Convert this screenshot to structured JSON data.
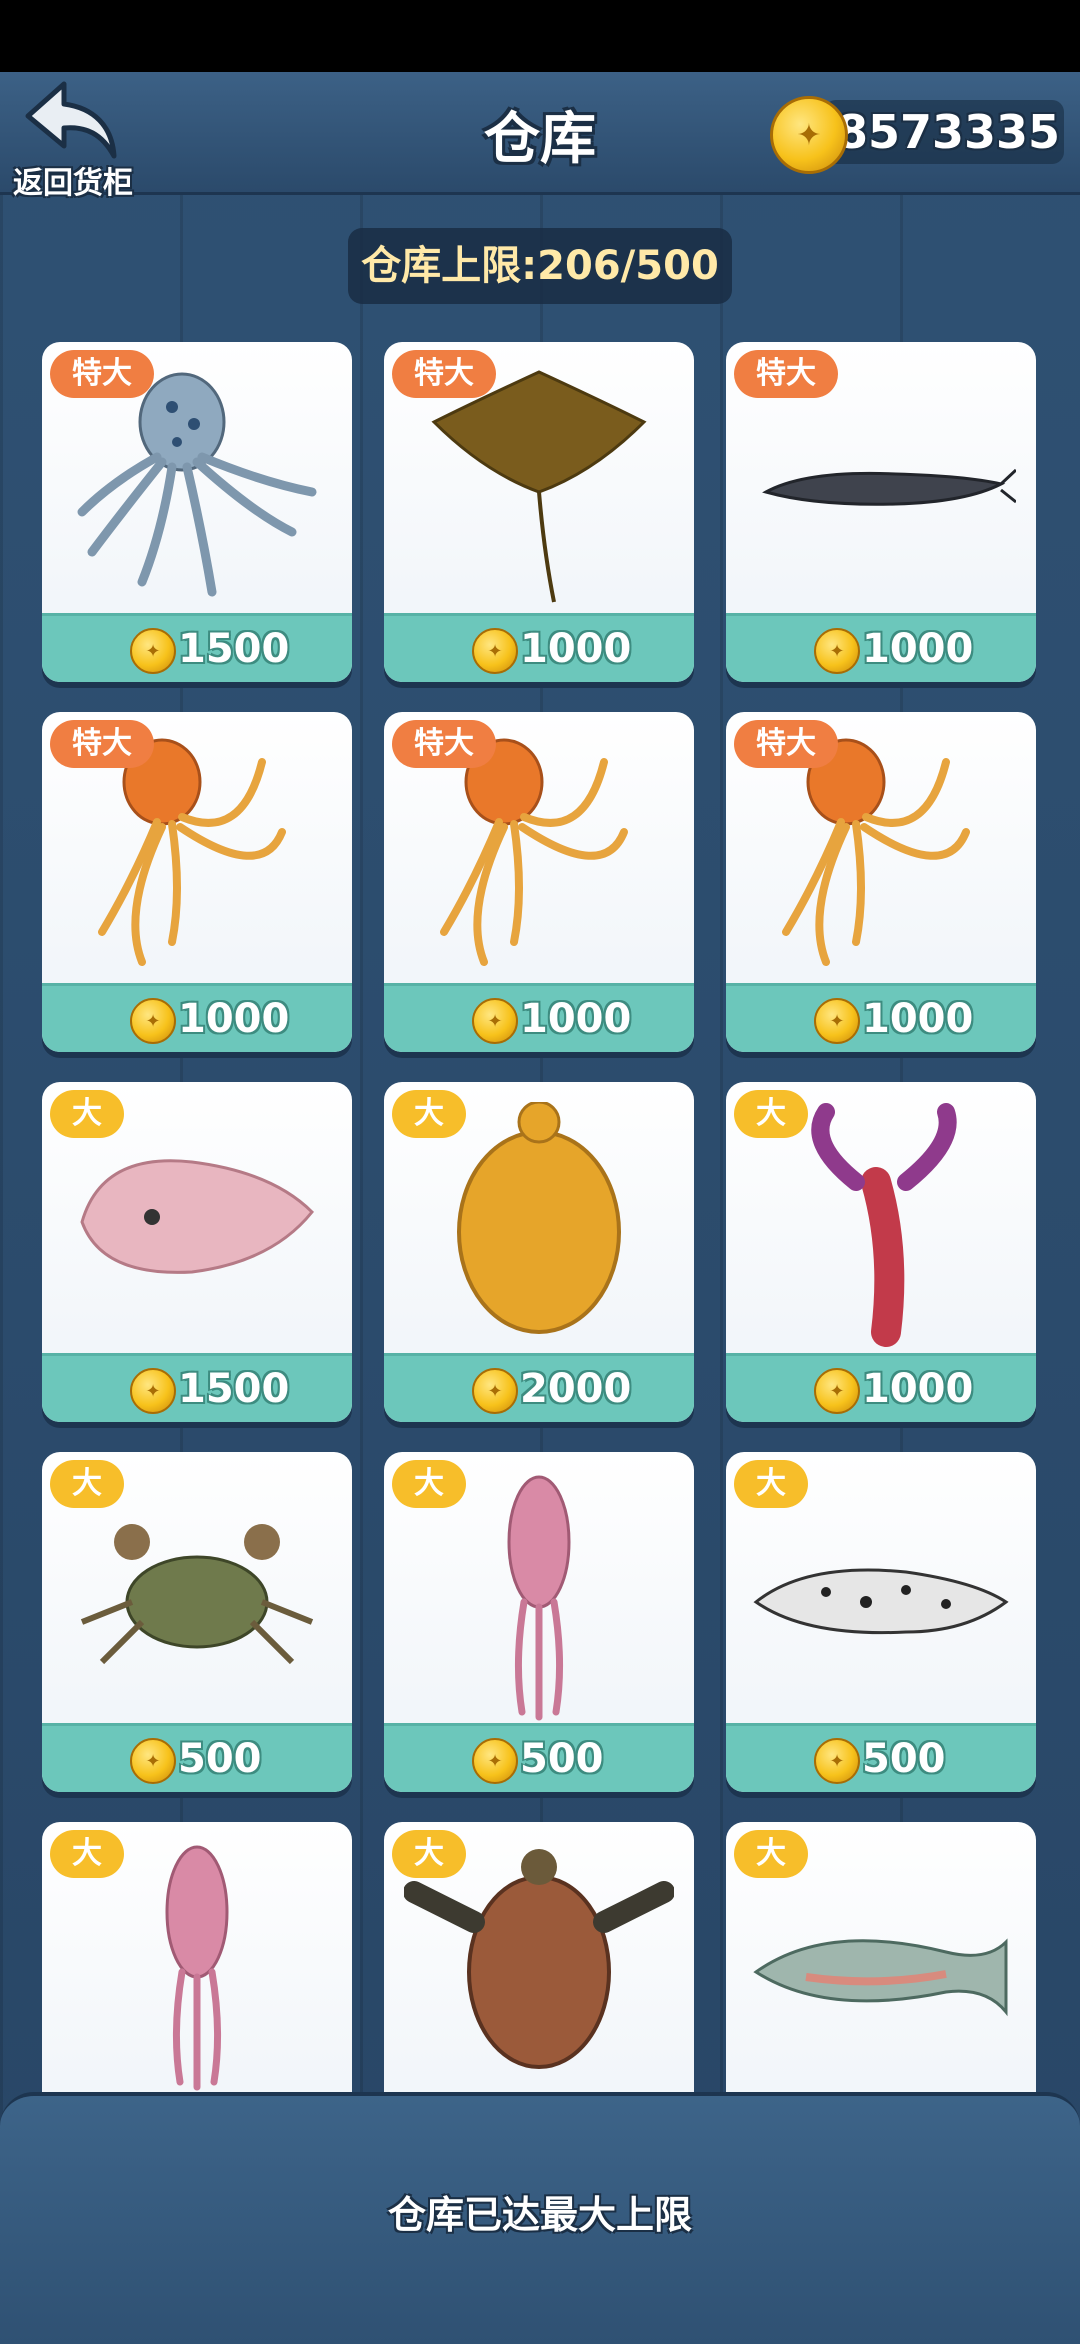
{
  "header": {
    "back_label": "返回货柜",
    "title": "仓库",
    "coins": "8573335"
  },
  "capacity_label": "仓库上限:206/500",
  "items": [
    {
      "size": "特大",
      "price": "1500",
      "creature": "blue-ringed-octopus-icon"
    },
    {
      "size": "特大",
      "price": "1000",
      "creature": "stingray-icon"
    },
    {
      "size": "特大",
      "price": "1000",
      "creature": "catfish-icon"
    },
    {
      "size": "特大",
      "price": "1000",
      "creature": "orange-octopus-icon"
    },
    {
      "size": "特大",
      "price": "1000",
      "creature": "orange-octopus-icon"
    },
    {
      "size": "特大",
      "price": "1000",
      "creature": "orange-octopus-icon"
    },
    {
      "size": "大",
      "price": "1500",
      "creature": "blobfish-icon"
    },
    {
      "size": "大",
      "price": "2000",
      "creature": "golden-turtle-icon"
    },
    {
      "size": "大",
      "price": "1000",
      "creature": "crayfish-icon"
    },
    {
      "size": "大",
      "price": "500",
      "creature": "crab-icon"
    },
    {
      "size": "大",
      "price": "500",
      "creature": "pink-squid-icon"
    },
    {
      "size": "大",
      "price": "500",
      "creature": "spotted-catfish-icon"
    },
    {
      "size": "大",
      "price": "",
      "creature": "pink-squid-icon"
    },
    {
      "size": "大",
      "price": "",
      "creature": "sea-turtle-icon"
    },
    {
      "size": "大",
      "price": "",
      "creature": "salmon-icon"
    }
  ],
  "footer_message": "仓库已达最大上限",
  "colors": {
    "background": "#2b4a6b",
    "price_bar": "#6cc7bb",
    "badge_extra_large": "#f07e42",
    "badge_large": "#f7be2a"
  }
}
